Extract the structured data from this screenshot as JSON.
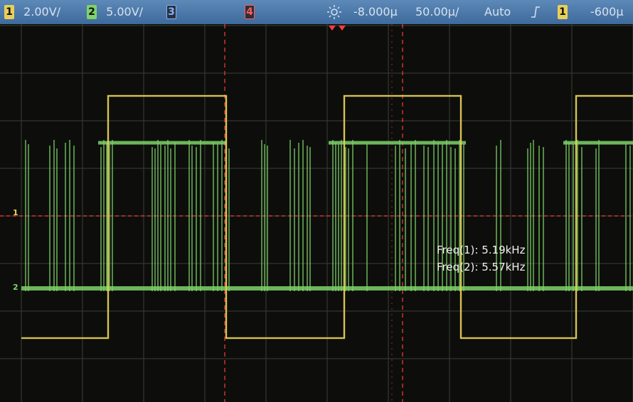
{
  "status_bar": {
    "ch1": {
      "num": "1",
      "scale": "2.00V/"
    },
    "ch2": {
      "num": "2",
      "scale": "5.00V/"
    },
    "ch3": {
      "num": "3"
    },
    "ch4": {
      "num": "4"
    },
    "time_offset": "-8.000µ",
    "time_scale": "50.00µ/",
    "trigger_mode": "Auto",
    "trigger_slope_icon": "rising-edge-icon",
    "trigger_source": "1",
    "trigger_level": "-600µ"
  },
  "channel_markers": {
    "ch1": "1",
    "ch2": "2"
  },
  "measurements": [
    {
      "label": "Freq(1):",
      "value": "5.19kHz"
    },
    {
      "label": "Freq(2):",
      "value": "5.57kHz"
    }
  ],
  "colors": {
    "ch1": "#e8d058",
    "ch2": "#7ed36a",
    "cursor": "#ff3b3b",
    "grid": "#3a3d3a"
  }
}
